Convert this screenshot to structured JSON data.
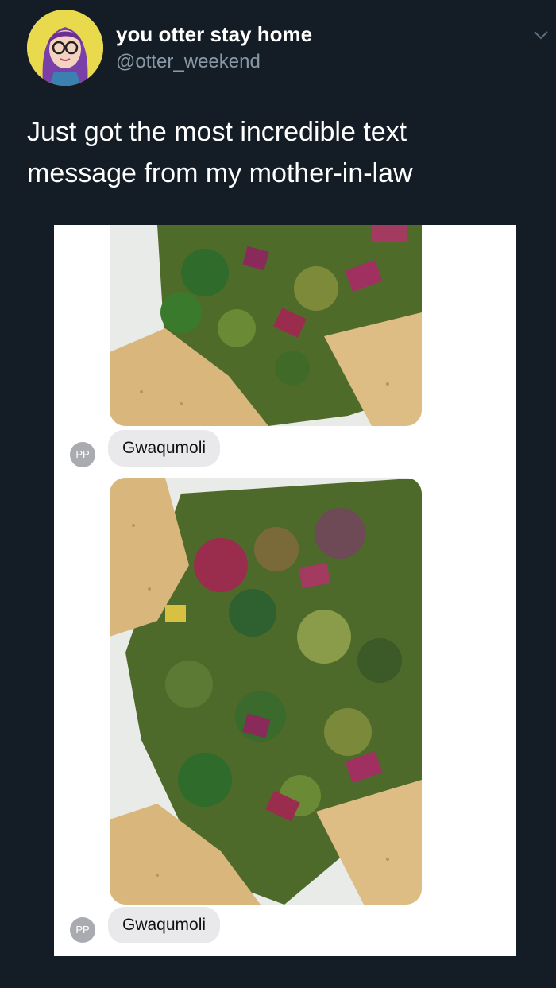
{
  "tweet": {
    "display_name": "you otter stay home",
    "handle": "@otter_weekend",
    "text": "Just got the most incredible text message from my mother-in-law",
    "avatar_icon": "user-avatar",
    "menu_icon": "chevron-down-icon"
  },
  "messages": [
    {
      "photo_subject": "guacamole-with-tortilla-chips",
      "sender_initials": "PP",
      "text": "Gwaqumoli"
    },
    {
      "photo_subject": "guacamole-with-tortilla-chips",
      "sender_initials": "PP",
      "text": "Gwaqumoli"
    }
  ],
  "colors": {
    "background": "#141d26",
    "name": "#ffffff",
    "handle": "#8899a6",
    "bubble": "#e9e9eb",
    "badge": "#a9abb0"
  }
}
